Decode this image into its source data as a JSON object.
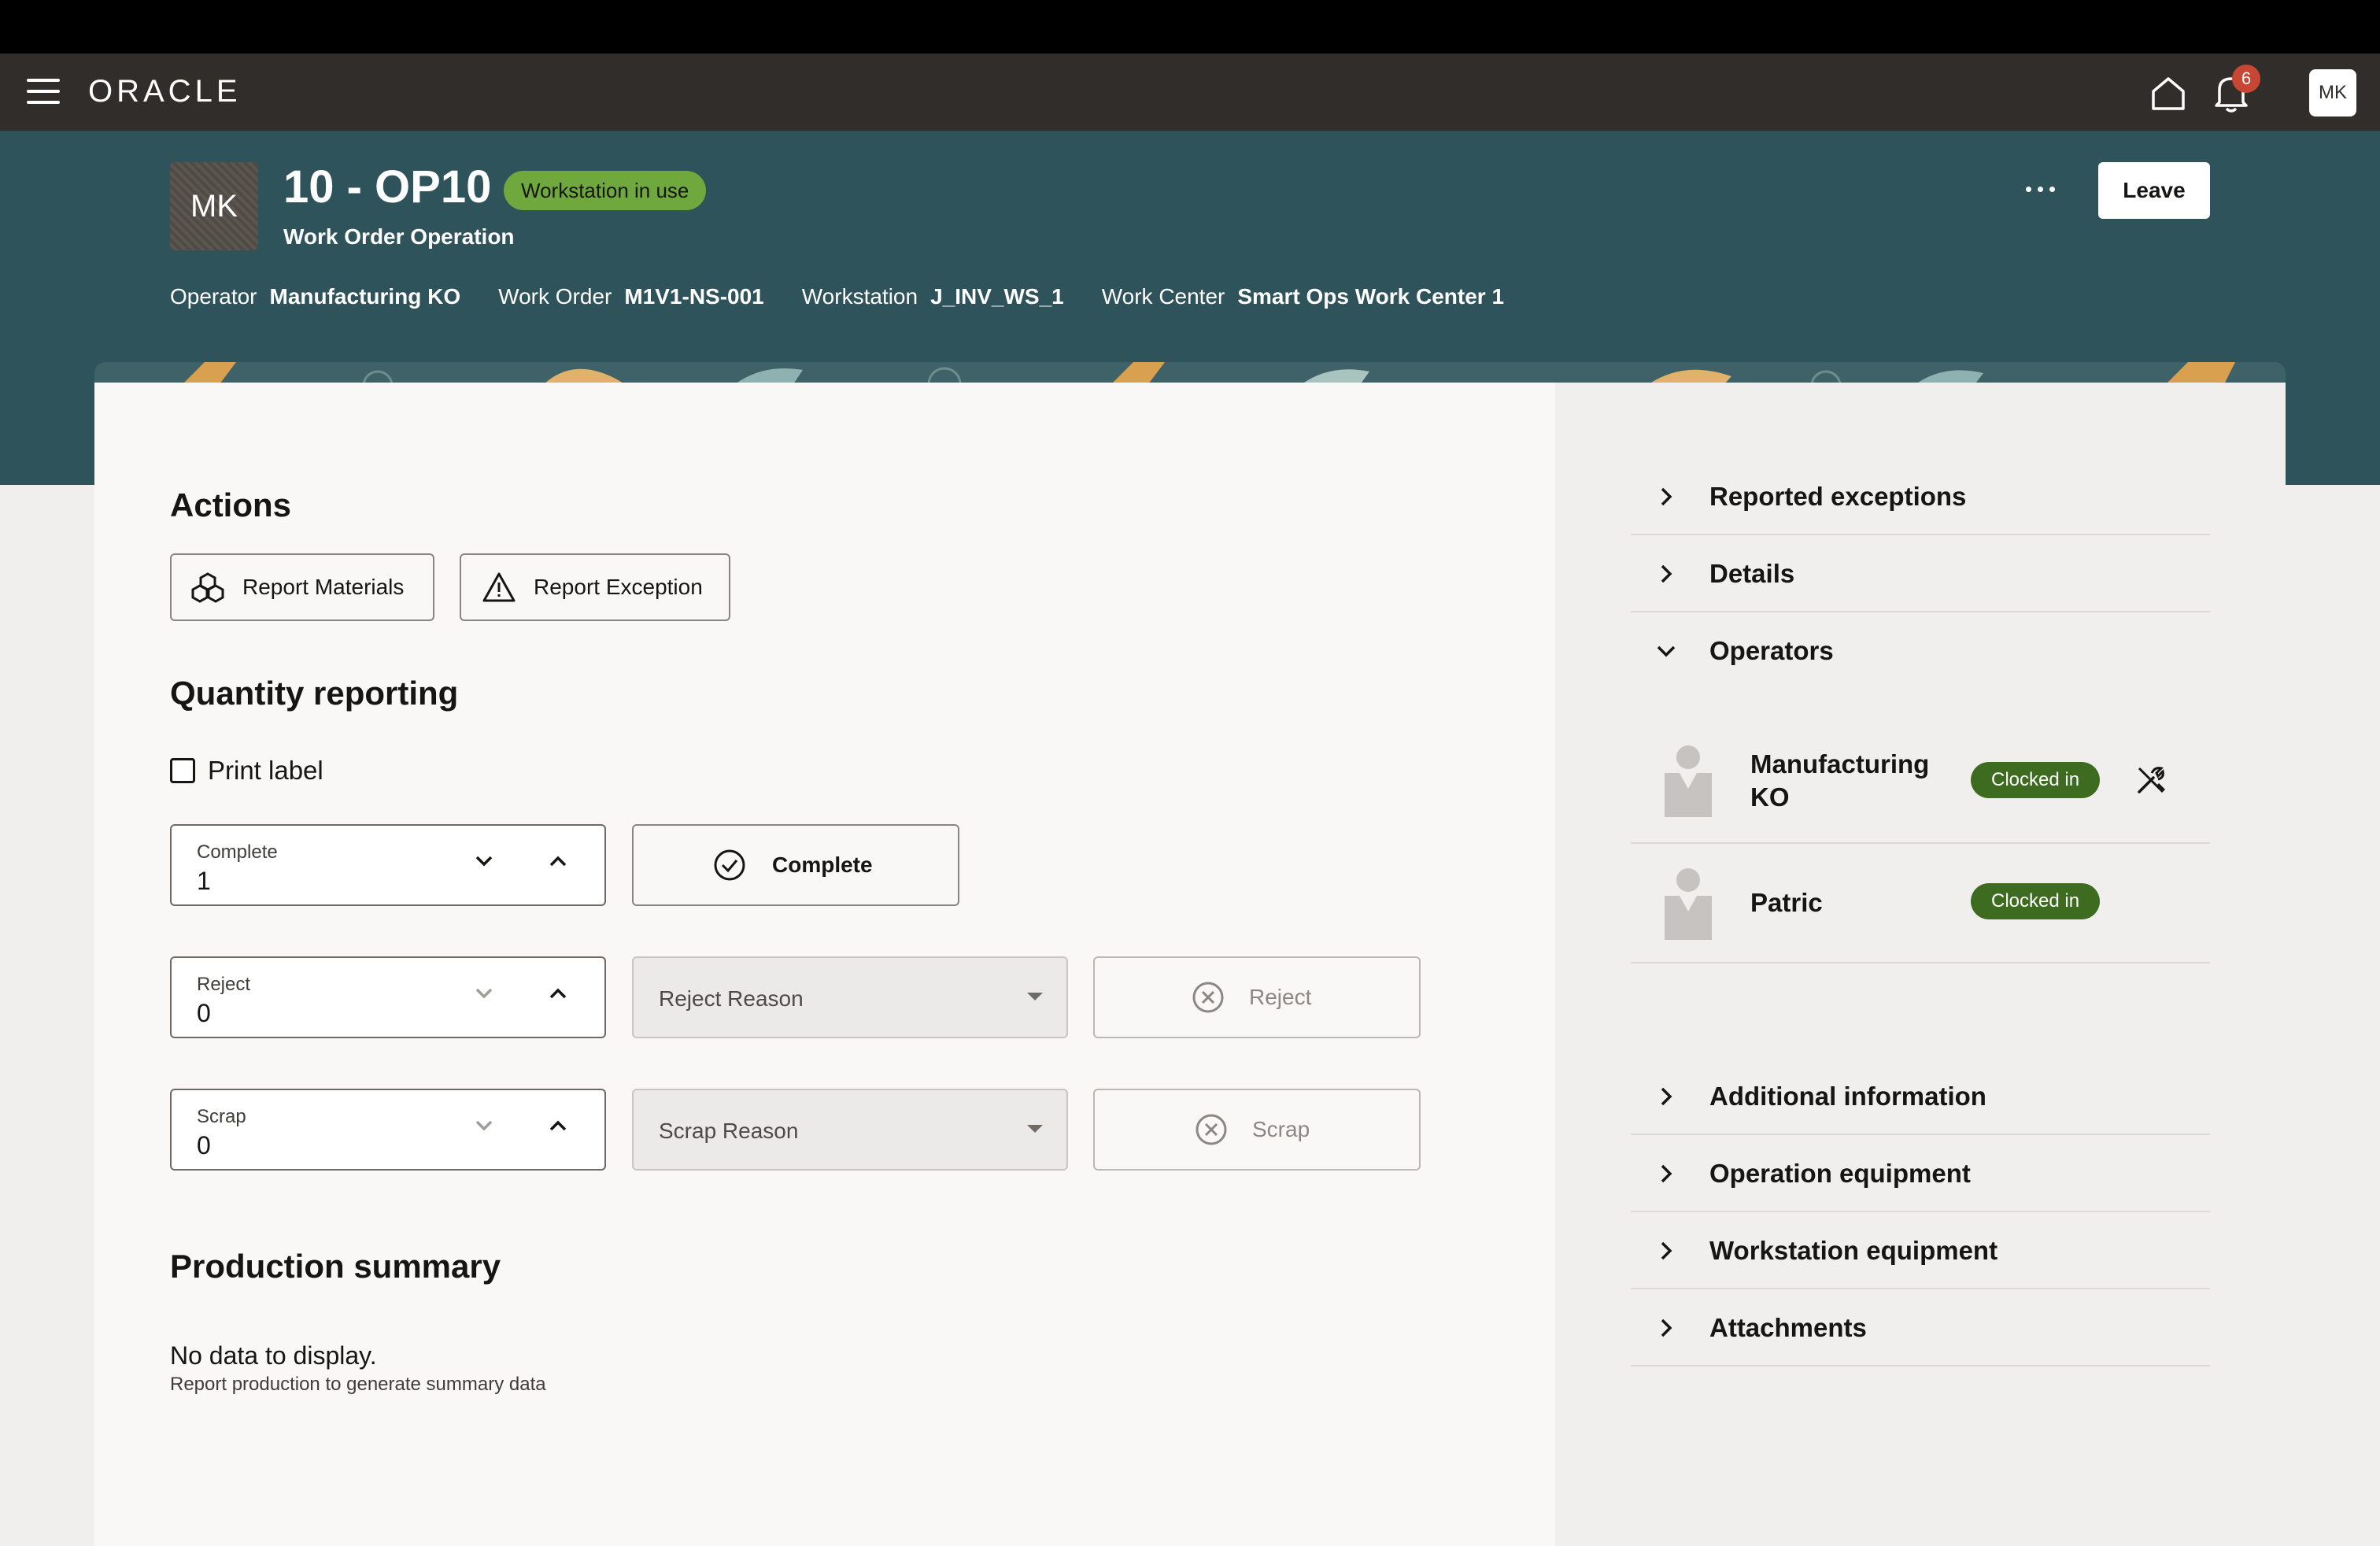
{
  "app": {
    "brand": "ORACLE",
    "notification_count": "6",
    "user_initials": "MK"
  },
  "header": {
    "avatar_initials": "MK",
    "title": "10 - OP10",
    "status": "Workstation in use",
    "subtitle": "Work Order Operation",
    "leave_label": "Leave",
    "meta": {
      "operator_label": "Operator",
      "operator_value": "Manufacturing KO",
      "work_order_label": "Work Order",
      "work_order_value": "M1V1-NS-001",
      "workstation_label": "Workstation",
      "workstation_value": "J_INV_WS_1",
      "work_center_label": "Work Center",
      "work_center_value": "Smart Ops Work Center 1"
    }
  },
  "actions": {
    "title": "Actions",
    "report_materials": "Report Materials",
    "report_exception": "Report Exception"
  },
  "quantity": {
    "title": "Quantity reporting",
    "print_label": "Print label",
    "complete": {
      "label": "Complete",
      "value": "1",
      "button": "Complete"
    },
    "reject": {
      "label": "Reject",
      "value": "0",
      "reason_placeholder": "Reject Reason",
      "button": "Reject"
    },
    "scrap": {
      "label": "Scrap",
      "value": "0",
      "reason_placeholder": "Scrap Reason",
      "button": "Scrap"
    }
  },
  "summary": {
    "title": "Production summary",
    "empty": "No data to display.",
    "hint": "Report production to generate summary data"
  },
  "side": {
    "sections_top": [
      "Reported exceptions",
      "Details"
    ],
    "operators_title": "Operators",
    "operators": [
      {
        "name_line1": "Manufacturing",
        "name_line2": "KO",
        "status": "Clocked in"
      },
      {
        "name_line1": "Patric",
        "name_line2": "",
        "status": "Clocked in"
      }
    ],
    "sections_bottom": [
      "Additional information",
      "Operation equipment",
      "Workstation equipment",
      "Attachments"
    ]
  },
  "colors": {
    "appbar": "#312d2a",
    "header_teal": "#2f535a",
    "status_green": "#6fa83d",
    "clocked_green": "#3d6b20",
    "badge_red": "#c74634"
  }
}
